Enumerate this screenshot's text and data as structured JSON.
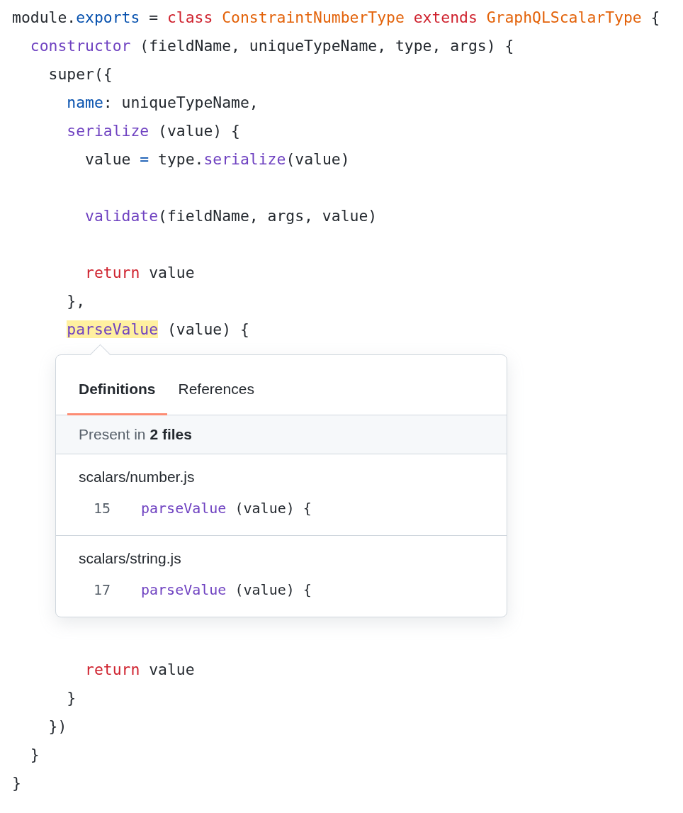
{
  "code": {
    "lines": [
      {
        "kind": "code",
        "tokens": [
          {
            "text": "module.",
            "kind": "plain"
          },
          {
            "text": "exports",
            "kind": "constant"
          },
          {
            "text": " = ",
            "kind": "plain"
          },
          {
            "text": "class ",
            "kind": "keyword"
          },
          {
            "text": "ConstraintNumberType ",
            "kind": "type"
          },
          {
            "text": "extends ",
            "kind": "keyword"
          },
          {
            "text": "GraphQLScalarType",
            "kind": "type"
          },
          {
            "text": " {",
            "kind": "plain"
          }
        ]
      },
      {
        "kind": "code",
        "tokens": [
          {
            "text": "  constructor",
            "kind": "function"
          },
          {
            "text": " (fieldName, uniqueTypeName, type, args) {",
            "kind": "plain"
          }
        ]
      },
      {
        "kind": "code",
        "tokens": [
          {
            "text": "    super({",
            "kind": "plain"
          }
        ]
      },
      {
        "kind": "code",
        "tokens": [
          {
            "text": "      name",
            "kind": "constant"
          },
          {
            "text": ": uniqueTypeName,",
            "kind": "plain"
          }
        ]
      },
      {
        "kind": "code",
        "tokens": [
          {
            "text": "      serialize",
            "kind": "function"
          },
          {
            "text": " (value) {",
            "kind": "plain"
          }
        ]
      },
      {
        "kind": "code",
        "tokens": [
          {
            "text": "        value ",
            "kind": "plain"
          },
          {
            "text": "=",
            "kind": "constant"
          },
          {
            "text": " type.",
            "kind": "plain"
          },
          {
            "text": "serialize",
            "kind": "function"
          },
          {
            "text": "(value)",
            "kind": "plain"
          }
        ]
      },
      {
        "kind": "blank"
      },
      {
        "kind": "code",
        "tokens": [
          {
            "text": "        validate",
            "kind": "function"
          },
          {
            "text": "(fieldName, args, value)",
            "kind": "plain"
          }
        ]
      },
      {
        "kind": "blank"
      },
      {
        "kind": "code",
        "tokens": [
          {
            "text": "        return",
            "kind": "keyword"
          },
          {
            "text": " value",
            "kind": "plain"
          }
        ]
      },
      {
        "kind": "code",
        "tokens": [
          {
            "text": "      },",
            "kind": "plain"
          }
        ]
      },
      {
        "kind": "code",
        "tokens": [
          {
            "text": "      parseValue",
            "kind": "function",
            "highlighted": true
          },
          {
            "text": " (value) {",
            "kind": "plain"
          }
        ]
      },
      {
        "kind": "blank"
      },
      {
        "kind": "blank"
      },
      {
        "kind": "blank"
      },
      {
        "kind": "blank"
      },
      {
        "kind": "blank"
      },
      {
        "kind": "blank"
      },
      {
        "kind": "blank"
      },
      {
        "kind": "blank"
      },
      {
        "kind": "blank"
      },
      {
        "kind": "blank"
      },
      {
        "kind": "blank"
      },
      {
        "kind": "code",
        "tokens": [
          {
            "text": "        return",
            "kind": "keyword"
          },
          {
            "text": " value",
            "kind": "plain"
          }
        ]
      },
      {
        "kind": "code",
        "tokens": [
          {
            "text": "      }",
            "kind": "plain"
          }
        ]
      },
      {
        "kind": "code",
        "tokens": [
          {
            "text": "    })",
            "kind": "plain"
          }
        ]
      },
      {
        "kind": "code",
        "tokens": [
          {
            "text": "  }",
            "kind": "plain"
          }
        ]
      },
      {
        "kind": "code",
        "tokens": [
          {
            "text": "}",
            "kind": "plain"
          }
        ]
      }
    ]
  },
  "popover": {
    "tabs": [
      {
        "label": "Definitions",
        "selected": true
      },
      {
        "label": "References",
        "selected": false
      }
    ],
    "summary": "Present in **2 files**",
    "results": [
      {
        "file": "scalars/number.js",
        "line_number": "15",
        "tokens": [
          {
            "text": "parseValue",
            "kind": "function"
          },
          {
            "text": " (value) {",
            "kind": "plain"
          }
        ]
      },
      {
        "file": "scalars/string.js",
        "line_number": "17",
        "tokens": [
          {
            "text": "parseValue",
            "kind": "function"
          },
          {
            "text": " (value) {",
            "kind": "plain"
          }
        ]
      }
    ]
  }
}
